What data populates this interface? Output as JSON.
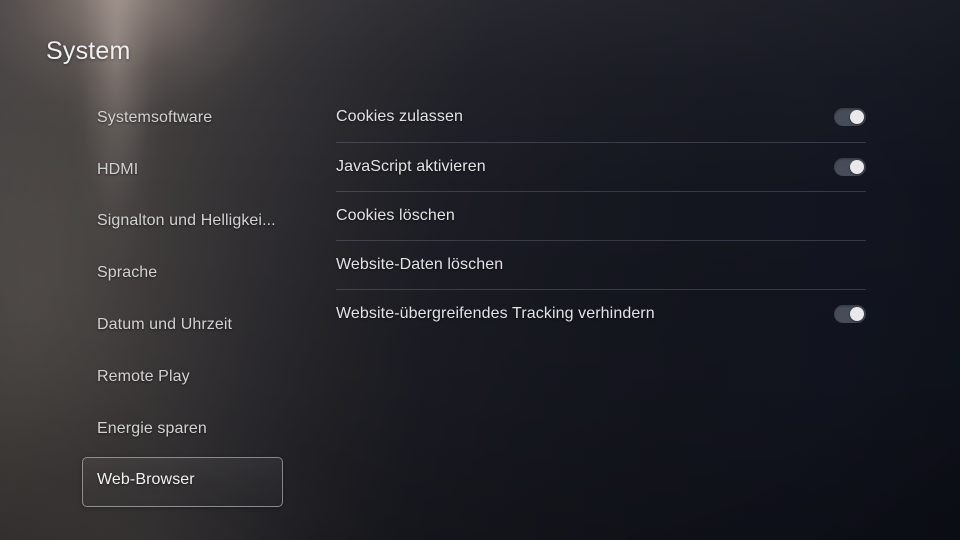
{
  "header": {
    "title": "System"
  },
  "sidebar": {
    "items": [
      {
        "label": "Systemsoftware",
        "selected": false
      },
      {
        "label": "HDMI",
        "selected": false
      },
      {
        "label": "Signalton und Helligkei...",
        "selected": false
      },
      {
        "label": "Sprache",
        "selected": false
      },
      {
        "label": "Datum und Uhrzeit",
        "selected": false
      },
      {
        "label": "Remote Play",
        "selected": false
      },
      {
        "label": "Energie sparen",
        "selected": false
      },
      {
        "label": "Web-Browser",
        "selected": true
      }
    ]
  },
  "main": {
    "rows": [
      {
        "label": "Cookies zulassen",
        "control": "toggle",
        "state": "on"
      },
      {
        "label": "JavaScript aktivieren",
        "control": "toggle",
        "state": "on"
      },
      {
        "label": "Cookies löschen",
        "control": "none",
        "state": ""
      },
      {
        "label": "Website-Daten löschen",
        "control": "none",
        "state": ""
      },
      {
        "label": "Website-übergreifendes Tracking verhindern",
        "control": "toggle",
        "state": "on"
      }
    ]
  },
  "colors": {
    "accent_glow": "#e4cec4",
    "background_dark": "#121520",
    "background_light": "#4c4847",
    "text_primary": "#e3e3e5",
    "toggle_track_on": "#474c59",
    "toggle_knob": "#e9e9ea",
    "divider": "#4a4d57",
    "selection_border": "#c4c4c6"
  }
}
